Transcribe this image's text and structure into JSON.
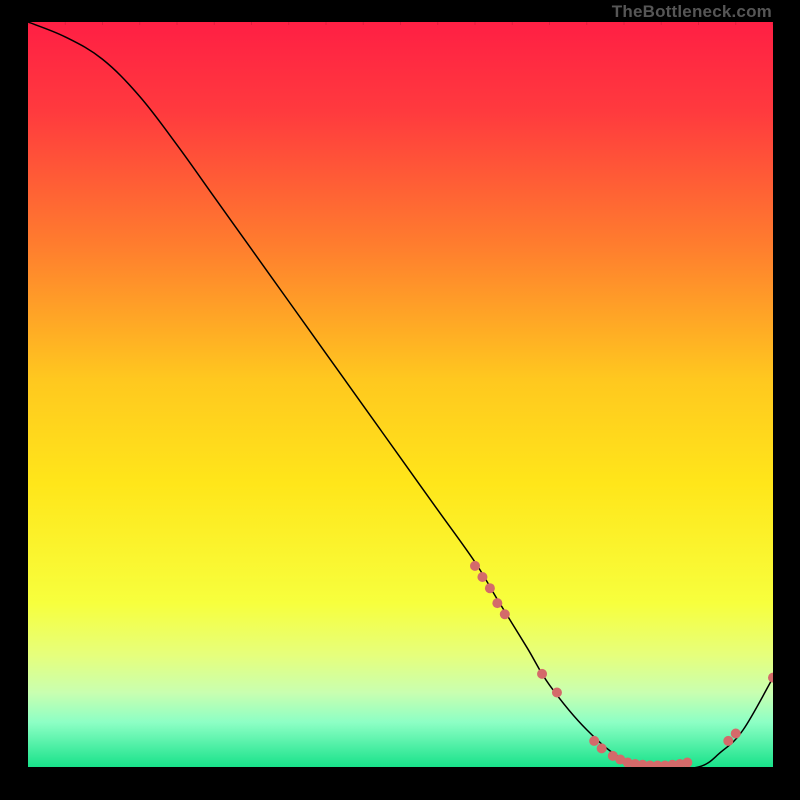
{
  "watermark": "TheBottleneck.com",
  "chart_data": {
    "type": "line",
    "title": "",
    "xlabel": "",
    "ylabel": "",
    "xlim": [
      0,
      100
    ],
    "ylim": [
      0,
      100
    ],
    "background_gradient": {
      "stops": [
        {
          "offset": 0.0,
          "color": "#ff1f44"
        },
        {
          "offset": 0.12,
          "color": "#ff3a3e"
        },
        {
          "offset": 0.3,
          "color": "#ff7d2e"
        },
        {
          "offset": 0.48,
          "color": "#ffc81f"
        },
        {
          "offset": 0.62,
          "color": "#ffe61a"
        },
        {
          "offset": 0.78,
          "color": "#f7ff3d"
        },
        {
          "offset": 0.85,
          "color": "#e6ff7c"
        },
        {
          "offset": 0.9,
          "color": "#c9ffb0"
        },
        {
          "offset": 0.94,
          "color": "#8dffc5"
        },
        {
          "offset": 1.0,
          "color": "#18e28a"
        }
      ]
    },
    "series": [
      {
        "name": "bottleneck-curve",
        "x": [
          0,
          5,
          10,
          15,
          20,
          25,
          30,
          35,
          40,
          45,
          50,
          55,
          60,
          63,
          67,
          70,
          75,
          80,
          85,
          90,
          93,
          96,
          100
        ],
        "y": [
          100,
          98,
          95,
          90,
          83.5,
          76.5,
          69.5,
          62.5,
          55.5,
          48.5,
          41.5,
          34.5,
          27.5,
          22.5,
          16,
          11,
          5,
          1,
          0,
          0,
          2,
          5,
          12
        ],
        "color": "#000000",
        "width": 1.5
      }
    ],
    "markers": [
      {
        "x": 60,
        "y": 27.0,
        "color": "#d46a6a",
        "r": 5
      },
      {
        "x": 61,
        "y": 25.5,
        "color": "#d46a6a",
        "r": 5
      },
      {
        "x": 62,
        "y": 24.0,
        "color": "#d46a6a",
        "r": 5
      },
      {
        "x": 63,
        "y": 22.0,
        "color": "#d46a6a",
        "r": 5
      },
      {
        "x": 64,
        "y": 20.5,
        "color": "#d46a6a",
        "r": 5
      },
      {
        "x": 69,
        "y": 12.5,
        "color": "#d46a6a",
        "r": 5
      },
      {
        "x": 71,
        "y": 10.0,
        "color": "#d46a6a",
        "r": 5
      },
      {
        "x": 76,
        "y": 3.5,
        "color": "#d46a6a",
        "r": 5
      },
      {
        "x": 77,
        "y": 2.5,
        "color": "#d46a6a",
        "r": 5
      },
      {
        "x": 78.5,
        "y": 1.5,
        "color": "#d46a6a",
        "r": 5
      },
      {
        "x": 79.5,
        "y": 1.0,
        "color": "#d46a6a",
        "r": 5
      },
      {
        "x": 80.5,
        "y": 0.6,
        "color": "#d46a6a",
        "r": 5
      },
      {
        "x": 81.5,
        "y": 0.4,
        "color": "#d46a6a",
        "r": 5
      },
      {
        "x": 82.5,
        "y": 0.3,
        "color": "#d46a6a",
        "r": 5
      },
      {
        "x": 83.5,
        "y": 0.2,
        "color": "#d46a6a",
        "r": 5
      },
      {
        "x": 84.5,
        "y": 0.2,
        "color": "#d46a6a",
        "r": 5
      },
      {
        "x": 85.5,
        "y": 0.2,
        "color": "#d46a6a",
        "r": 5
      },
      {
        "x": 86.5,
        "y": 0.3,
        "color": "#d46a6a",
        "r": 5
      },
      {
        "x": 87.5,
        "y": 0.4,
        "color": "#d46a6a",
        "r": 5
      },
      {
        "x": 88.5,
        "y": 0.6,
        "color": "#d46a6a",
        "r": 5
      },
      {
        "x": 94,
        "y": 3.5,
        "color": "#d46a6a",
        "r": 5
      },
      {
        "x": 95,
        "y": 4.5,
        "color": "#d46a6a",
        "r": 5
      },
      {
        "x": 100,
        "y": 12.0,
        "color": "#d46a6a",
        "r": 5
      }
    ]
  }
}
